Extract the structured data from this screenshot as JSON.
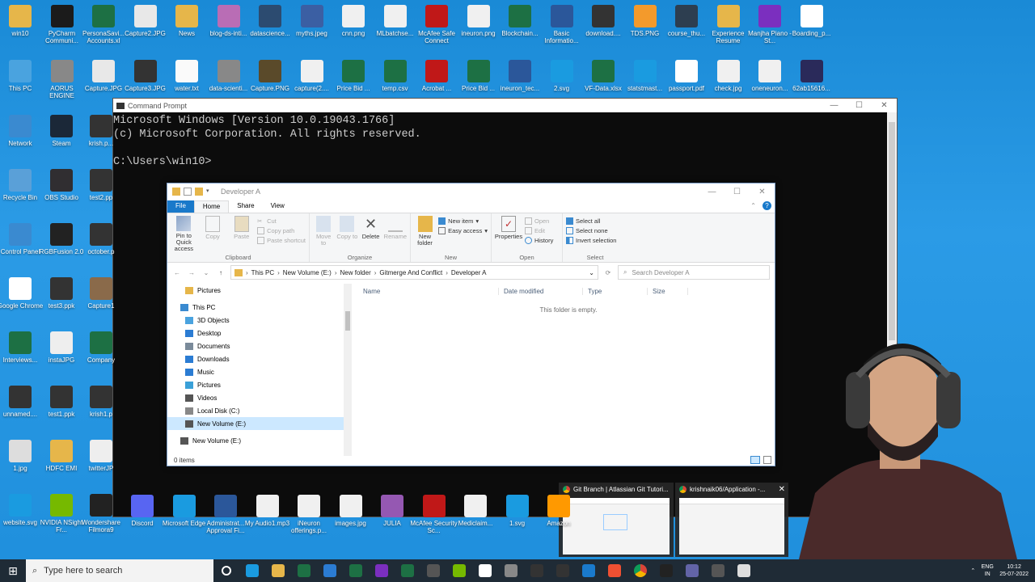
{
  "desktop_icons": [
    {
      "label": "win10",
      "color": "#e6b64a",
      "glyph": "folder-icon"
    },
    {
      "label": "PyCharm Communi...",
      "color": "#1b1b1b",
      "glyph": "pycharm-icon"
    },
    {
      "label": "PersonaSavi... Accounts.xl",
      "color": "#1d7044",
      "glyph": "excel-icon"
    },
    {
      "label": "Capture2.JPG",
      "color": "#e8e8e8",
      "glyph": "image-icon"
    },
    {
      "label": "News",
      "color": "#e6b64a",
      "glyph": "folder-icon"
    },
    {
      "label": "blog-ds-inti...",
      "color": "#b96db5",
      "glyph": "image-icon"
    },
    {
      "label": "datascience...",
      "color": "#2c4b70",
      "glyph": "image-icon"
    },
    {
      "label": "myths.jpeg",
      "color": "#3b5fa3",
      "glyph": "image-icon"
    },
    {
      "label": "cnn.png",
      "color": "#f0f0f0",
      "glyph": "image-icon"
    },
    {
      "label": "MLbatchse...",
      "color": "#f0f0f0",
      "glyph": "image-icon"
    },
    {
      "label": "McAfee Safe Connect",
      "color": "#c01818",
      "glyph": "mcafee-icon"
    },
    {
      "label": "ineuron.png",
      "color": "#f0f0f0",
      "glyph": "image-icon"
    },
    {
      "label": "Blockchain...",
      "color": "#1d7044",
      "glyph": "excel-icon"
    },
    {
      "label": "Basic Informatio...",
      "color": "#2b579a",
      "glyph": "word-icon"
    },
    {
      "label": "download....",
      "color": "#333",
      "glyph": "image-icon"
    },
    {
      "label": "TDS.PNG",
      "color": "#f39a2c",
      "glyph": "image-icon"
    },
    {
      "label": "course_thu...",
      "color": "#2d3e50",
      "glyph": "image-icon"
    },
    {
      "label": "Experience Resume",
      "color": "#e6b64a",
      "glyph": "zip-icon"
    },
    {
      "label": "Manjha Piano - St...",
      "color": "#7b2fbf",
      "glyph": "audio-icon"
    },
    {
      "label": "Boarding_p...",
      "color": "#ffffff",
      "glyph": "chrome-icon"
    }
  ],
  "desktop_icons_row2": [
    {
      "label": "This PC",
      "color": "#4aa3df",
      "glyph": "pc-icon"
    },
    {
      "label": "AORUS ENGINE",
      "color": "#888",
      "glyph": "app-icon"
    },
    {
      "label": "Capture.JPG",
      "color": "#e8e8e8",
      "glyph": "image-icon"
    },
    {
      "label": "Capture3.JPG",
      "color": "#333",
      "glyph": "image-icon"
    },
    {
      "label": "water.txt",
      "color": "#fafafa",
      "glyph": "text-icon"
    },
    {
      "label": "data-scienti...",
      "color": "#888",
      "glyph": "image-icon"
    },
    {
      "label": "Capture.PNG",
      "color": "#5a4a2a",
      "glyph": "image-icon"
    },
    {
      "label": "capture(2....",
      "color": "#f0f0f0",
      "glyph": "image-icon"
    },
    {
      "label": "Price Bid ...",
      "color": "#1d7044",
      "glyph": "excel-icon"
    },
    {
      "label": "temp.csv",
      "color": "#1d7044",
      "glyph": "excel-icon"
    },
    {
      "label": "Acrobat ...",
      "color": "#c01818",
      "glyph": "acrobat-icon"
    },
    {
      "label": "Price Bid ...",
      "color": "#1d7044",
      "glyph": "excel-icon"
    },
    {
      "label": "ineuron_tec...",
      "color": "#2b579a",
      "glyph": "word-icon"
    },
    {
      "label": "2.svg",
      "color": "#1a9be0",
      "glyph": "edge-icon"
    },
    {
      "label": "VF-Data.xlsx",
      "color": "#1d7044",
      "glyph": "excel-icon"
    },
    {
      "label": "statstmast...",
      "color": "#1a9be0",
      "glyph": "edge-icon"
    },
    {
      "label": "passport.pdf",
      "color": "#ffffff",
      "glyph": "chrome-icon"
    },
    {
      "label": "check.jpg",
      "color": "#f0f0f0",
      "glyph": "image-icon"
    },
    {
      "label": "oneneuron...",
      "color": "#f0f0f0",
      "glyph": "image-icon"
    },
    {
      "label": "62ab15616...",
      "color": "#2a2a5a",
      "glyph": "image-icon"
    }
  ],
  "left_col_icons": [
    {
      "label": "Network",
      "color": "#3a8ad0"
    },
    {
      "label": "Recycle Bin",
      "color": "#5aa0d8"
    },
    {
      "label": "Control Panel",
      "color": "#3a8ad0"
    },
    {
      "label": "Google Chrome",
      "color": "#ffffff"
    },
    {
      "label": "Interviews...",
      "color": "#1d7044"
    },
    {
      "label": "unnamed....",
      "color": "#333"
    },
    {
      "label": "1.jpg",
      "color": "#ddd"
    },
    {
      "label": "website.svg",
      "color": "#1a9be0"
    }
  ],
  "col2_icons": [
    {
      "label": "Steam",
      "color": "#1b2838"
    },
    {
      "label": "OBS Studio",
      "color": "#302e31"
    },
    {
      "label": "RGBFusion 2.0",
      "color": "#222"
    },
    {
      "label": "test3.ppk",
      "color": "#333"
    },
    {
      "label": "instaJPG",
      "color": "#eee"
    },
    {
      "label": "test1.ppk",
      "color": "#333"
    },
    {
      "label": "HDFC EMI",
      "color": "#e6b64a"
    },
    {
      "label": "NVIDIA NSight Fr...",
      "color": "#76b900"
    }
  ],
  "col3_icons": [
    {
      "label": "krish.p...",
      "color": "#333"
    },
    {
      "label": "test2.pp",
      "color": "#333"
    },
    {
      "label": "october.p",
      "color": "#333"
    },
    {
      "label": "Capture1",
      "color": "#8a6a4a"
    },
    {
      "label": "Company",
      "color": "#1d7044"
    },
    {
      "label": "krish1.p",
      "color": "#333"
    },
    {
      "label": "twitterJP",
      "color": "#eee"
    },
    {
      "label": "Wondershare Filmora9",
      "color": "#222"
    }
  ],
  "bottom_row_icons": [
    {
      "label": "Discord",
      "color": "#5865f2"
    },
    {
      "label": "Microsoft Edge",
      "color": "#1a9be0"
    },
    {
      "label": "Administrat... Approval Fi...",
      "color": "#2b579a"
    },
    {
      "label": "My Audio1.mp3",
      "color": "#f0f0f0"
    },
    {
      "label": "iNeuron offerings.p...",
      "color": "#f0f0f0"
    },
    {
      "label": "images.jpg",
      "color": "#f0f0f0"
    },
    {
      "label": "JULIA",
      "color": "#9558b2"
    },
    {
      "label": "McAfee Security Sc...",
      "color": "#c01818"
    },
    {
      "label": "Mediclaim...",
      "color": "#f0f0f0"
    },
    {
      "label": "1.svg",
      "color": "#1a9be0"
    },
    {
      "label": "Amazon",
      "color": "#ff9900"
    }
  ],
  "cmd": {
    "title": "Command Prompt",
    "lines": [
      "Microsoft Windows [Version 10.0.19043.1766]",
      "(c) Microsoft Corporation. All rights reserved.",
      "",
      "C:\\Users\\win10>"
    ]
  },
  "explorer": {
    "title": "Developer A",
    "tabs": {
      "file": "File",
      "home": "Home",
      "share": "Share",
      "view": "View"
    },
    "ribbon": {
      "pin": "Pin to Quick access",
      "copy": "Copy",
      "paste": "Paste",
      "cut": "Cut",
      "copy_path": "Copy path",
      "paste_shortcut": "Paste shortcut",
      "clipboard": "Clipboard",
      "move_to": "Move to",
      "copy_to": "Copy to",
      "delete": "Delete",
      "rename": "Rename",
      "organize": "Organize",
      "new_folder": "New folder",
      "new_item": "New item",
      "easy_access": "Easy access",
      "new": "New",
      "properties": "Properties",
      "open": "Open",
      "edit": "Edit",
      "history": "History",
      "open_group": "Open",
      "select_all": "Select all",
      "select_none": "Select none",
      "invert": "Invert selection",
      "select": "Select"
    },
    "path": [
      "This PC",
      "New Volume (E:)",
      "New folder",
      "Gitmerge And Conflict",
      "Developer A"
    ],
    "search_placeholder": "Search Developer A",
    "nav": [
      {
        "label": "Pictures",
        "color": "#e6b64a",
        "indent": 22,
        "sel": false
      },
      {
        "label": "This PC",
        "color": "#3a8ad0",
        "indent": 16,
        "sel": false
      },
      {
        "label": "3D Objects",
        "color": "#4aa3df",
        "indent": 22,
        "sel": false
      },
      {
        "label": "Desktop",
        "color": "#2b7cd3",
        "indent": 22,
        "sel": false
      },
      {
        "label": "Documents",
        "color": "#7a8a9a",
        "indent": 22,
        "sel": false
      },
      {
        "label": "Downloads",
        "color": "#2b7cd3",
        "indent": 22,
        "sel": false
      },
      {
        "label": "Music",
        "color": "#2b7cd3",
        "indent": 22,
        "sel": false
      },
      {
        "label": "Pictures",
        "color": "#3aa0d8",
        "indent": 22,
        "sel": false
      },
      {
        "label": "Videos",
        "color": "#555",
        "indent": 22,
        "sel": false
      },
      {
        "label": "Local Disk (C:)",
        "color": "#888",
        "indent": 22,
        "sel": false
      },
      {
        "label": "New Volume (E:)",
        "color": "#555",
        "indent": 22,
        "sel": true
      },
      {
        "label": "New Volume (E:)",
        "color": "#555",
        "indent": 16,
        "sel": false
      }
    ],
    "columns": {
      "name": "Name",
      "date": "Date modified",
      "type": "Type",
      "size": "Size"
    },
    "empty_text": "This folder is empty.",
    "status": "0 items"
  },
  "thumbnails": [
    {
      "title": "Git Branch | Atlassian Git Tutori..."
    },
    {
      "title": "krishnaik06/Application -..."
    }
  ],
  "taskbar": {
    "search_placeholder": "Type here to search",
    "lang": "ENG IN",
    "time": "10:12",
    "date": "25-07-2022"
  },
  "colors": {
    "accent": "#1979ca",
    "taskbar": "#1f2b36",
    "cmd_bg": "#0c0c0c"
  }
}
